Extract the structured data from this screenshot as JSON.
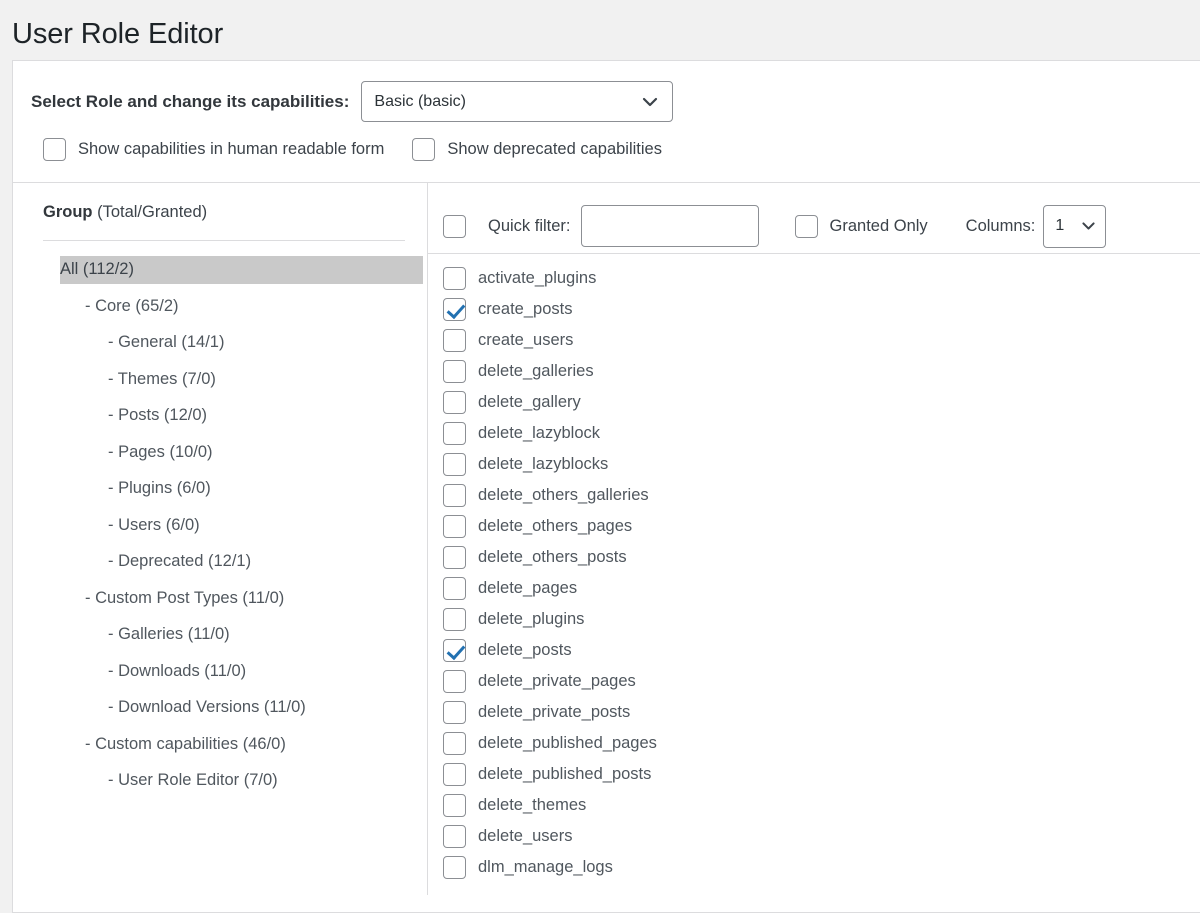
{
  "page": {
    "title": "User Role Editor"
  },
  "role_section": {
    "label": "Select Role and change its capabilities:",
    "selected_role": "Basic (basic)",
    "chevron_icon": "chevron-down-icon",
    "options": [
      "Basic (basic)"
    ]
  },
  "toggles": [
    {
      "label": "Show capabilities in human readable form",
      "checked": false
    },
    {
      "label": "Show deprecated capabilities",
      "checked": false
    }
  ],
  "group_panel": {
    "header_bold": "Group",
    "header_rest": " (Total/Granted)",
    "items": [
      {
        "label": "All (112/2)",
        "level": 0,
        "selected": true
      },
      {
        "label": "- Core (65/2)",
        "level": 1,
        "selected": false
      },
      {
        "label": "- General (14/1)",
        "level": 2,
        "selected": false
      },
      {
        "label": "- Themes (7/0)",
        "level": 2,
        "selected": false
      },
      {
        "label": "- Posts (12/0)",
        "level": 2,
        "selected": false
      },
      {
        "label": "- Pages (10/0)",
        "level": 2,
        "selected": false
      },
      {
        "label": "- Plugins (6/0)",
        "level": 2,
        "selected": false
      },
      {
        "label": "- Users (6/0)",
        "level": 2,
        "selected": false
      },
      {
        "label": "- Deprecated (12/1)",
        "level": 2,
        "selected": false
      },
      {
        "label": "- Custom Post Types (11/0)",
        "level": 1,
        "selected": false
      },
      {
        "label": "- Galleries (11/0)",
        "level": 2,
        "selected": false
      },
      {
        "label": "- Downloads (11/0)",
        "level": 2,
        "selected": false
      },
      {
        "label": "- Download Versions (11/0)",
        "level": 2,
        "selected": false
      },
      {
        "label": "- Custom capabilities (46/0)",
        "level": 1,
        "selected": false
      },
      {
        "label": "- User Role Editor (7/0)",
        "level": 2,
        "selected": false
      }
    ]
  },
  "cap_toolbar": {
    "select_all_checked": false,
    "quick_filter_label": "Quick filter:",
    "quick_filter_value": "",
    "quick_filter_placeholder": "",
    "granted_only_label": "Granted Only",
    "granted_only_checked": false,
    "columns_label": "Columns:",
    "columns_value": "1",
    "columns_chevron_icon": "chevron-down-icon",
    "columns_options": [
      "1"
    ]
  },
  "capabilities": [
    {
      "name": "activate_plugins",
      "checked": false
    },
    {
      "name": "create_posts",
      "checked": true
    },
    {
      "name": "create_users",
      "checked": false
    },
    {
      "name": "delete_galleries",
      "checked": false
    },
    {
      "name": "delete_gallery",
      "checked": false
    },
    {
      "name": "delete_lazyblock",
      "checked": false
    },
    {
      "name": "delete_lazyblocks",
      "checked": false
    },
    {
      "name": "delete_others_galleries",
      "checked": false
    },
    {
      "name": "delete_others_pages",
      "checked": false
    },
    {
      "name": "delete_others_posts",
      "checked": false
    },
    {
      "name": "delete_pages",
      "checked": false
    },
    {
      "name": "delete_plugins",
      "checked": false
    },
    {
      "name": "delete_posts",
      "checked": true
    },
    {
      "name": "delete_private_pages",
      "checked": false
    },
    {
      "name": "delete_private_posts",
      "checked": false
    },
    {
      "name": "delete_published_pages",
      "checked": false
    },
    {
      "name": "delete_published_posts",
      "checked": false
    },
    {
      "name": "delete_themes",
      "checked": false
    },
    {
      "name": "delete_users",
      "checked": false
    },
    {
      "name": "dlm_manage_logs",
      "checked": false
    }
  ],
  "colors": {
    "accent": "#2271b1",
    "page_bg": "#f1f1f1",
    "panel_bg": "#ffffff",
    "border": "#dcdcde",
    "selected_row": "#c9c9c9",
    "text": "#3c434a"
  }
}
